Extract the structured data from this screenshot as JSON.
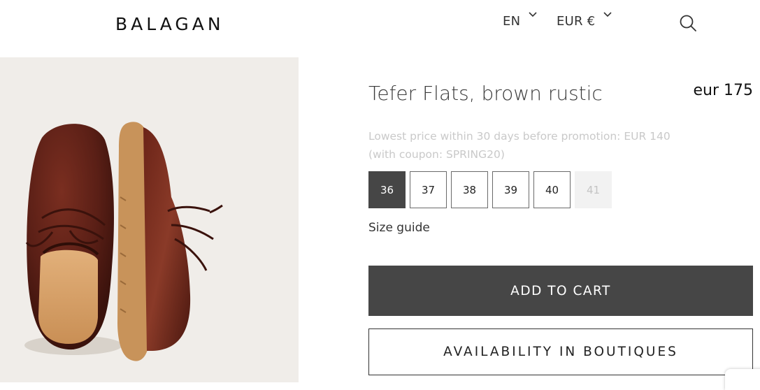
{
  "header": {
    "logo": "BALAGAN",
    "language": "EN",
    "currency": "EUR €"
  },
  "product": {
    "title": "Tefer Flats, brown rustic",
    "price": "eur 175",
    "promo_line1": "Lowest price within 30 days before promotion: EUR 140",
    "promo_line2": "(with coupon: SPRING20)",
    "sizes": [
      {
        "label": "36",
        "state": "selected"
      },
      {
        "label": "37",
        "state": "available"
      },
      {
        "label": "38",
        "state": "available"
      },
      {
        "label": "39",
        "state": "available"
      },
      {
        "label": "40",
        "state": "available"
      },
      {
        "label": "41",
        "state": "unavailable"
      }
    ],
    "size_guide": "Size guide",
    "add_to_cart": "ADD TO CART",
    "availability": "AVAILABILITY IN BOUTIQUES"
  },
  "colors": {
    "primary_button": "#464646",
    "image_background": "#f0ede9",
    "leather": "#5a1f16",
    "sole": "#c8935a",
    "promo_text": "#c9c9c9"
  },
  "icons": {
    "search": "search-icon",
    "dropdown": "chevron-down-icon"
  }
}
